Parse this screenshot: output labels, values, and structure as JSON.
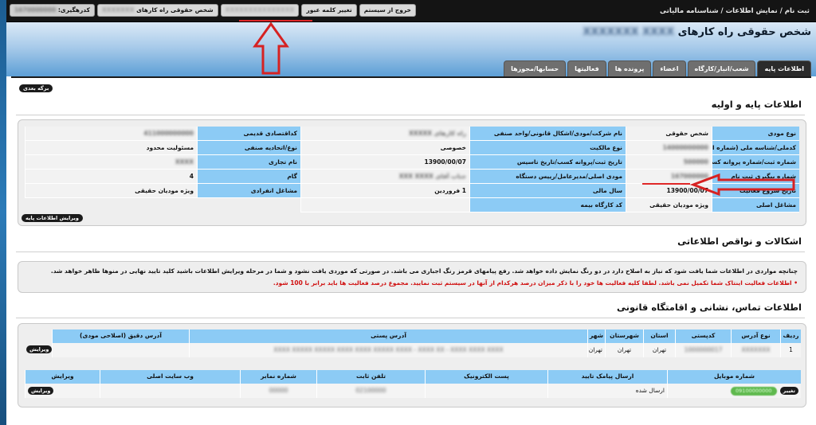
{
  "topbar": {
    "path": "ثبت نام / نمایش اطلاعات / شناسنامه مالیاتی",
    "buttons": {
      "exit": "خروج از سیستم",
      "change_password": "تغییر کلمه عبور",
      "blurred": "XXXXXXXXXXXXXXX",
      "profile_prefix": "شخص حقوقی راه کارهای",
      "profile_blur": "XXXXXXX",
      "tracking_label": "کدرهگیری:",
      "tracking_blur": "1670000000"
    }
  },
  "header": {
    "title": "شخص حقوقی راه کارهای",
    "title_blur": "XXXXXXX XXXX"
  },
  "tabs": [
    {
      "label": "اطلاعات پایه",
      "active": true
    },
    {
      "label": "شعب/انبار/کارگاه",
      "active": false
    },
    {
      "label": "اعضاء",
      "active": false
    },
    {
      "label": "پرونده ها",
      "active": false
    },
    {
      "label": "فعالیتها",
      "active": false
    },
    {
      "label": "حسابها/مجوزها",
      "active": false
    }
  ],
  "next_button": "برگه بعدی",
  "basic_section": {
    "title": "اطلاعات پایه و اولیه",
    "rows": [
      [
        "نوع مودی",
        "شخص حقوقی",
        "نام شرکت/مودی/اشکال قانونی/واحد صنفی",
        "راه کارهای XXXXX",
        "کداقتصادی قدیمی",
        "411000000000"
      ],
      [
        "کدملی/شناسه ملی (شماره اقتصادی)",
        "14000000000",
        "نوع مالکیت",
        "خصوصی",
        "نوع/اتحادیه صنفی",
        "مسئولیت محدود"
      ],
      [
        "شماره ثبت/شماره پروانه کسب",
        "500000",
        "تاریخ ثبت/پروانه کسب/تاریخ تاسیس",
        "13900/00/07",
        "نام تجاری",
        "XXXX"
      ],
      [
        "شماره پیگیری ثبت نام",
        "167000000",
        "مودی اصلی/مدیرعامل/رییس دستگاه",
        "جناب آقای XXX XXXX",
        "گام",
        "4"
      ],
      [
        "تاریخ شروع فعالیت",
        "13900/00/07",
        "سال مالی",
        "1 فروردین",
        "مشاغل انفرادی",
        "ویژه مودیان حقیقی"
      ],
      [
        "مشاغل اصلی",
        "ویژه مودیان حقیقی",
        "کد کارگاه بیمه",
        "",
        "",
        ""
      ]
    ],
    "edit_button": "ویرایش اطلاعات پایه"
  },
  "issues_section": {
    "title": "اشکالات و نواقص اطلاعاتی",
    "line1": "چنانچه مواردی در اطلاعات شما یافت شود که نیاز به اصلاح دارد در دو رنگ نمایش داده خواهد شد. رفع پیامهای قرمز رنگ اجباری می باشد. در صورتی که موردی یافت نشود و شما در مرحله ویرایش اطلاعات باشید کلید تایید نهایی در منوها ظاهر خواهد شد.",
    "line2": "• اطلاعات فعالیت اینتاک شما تکمیل نمی باشد. لطفا کلیه فعالیت ها خود را با ذکر میزان درصد هرکدام از آنها در سیستم ثبت نمایید. مجموع درصد فعالیت ها باید برابر با 100 شود."
  },
  "contact_section": {
    "title": "اطلاعات تماس، نشانی و اقامتگاه قانونی",
    "address_headers": [
      "ردیف",
      "نوع آدرس",
      "کدپستی",
      "استان",
      "شهرستان",
      "شهر",
      "آدرس پستی",
      "آدرس دقیق (اصلاحی مودی)"
    ],
    "address_row": [
      "1",
      "XXXXXXX",
      "1000000017",
      "تهران",
      "تهران",
      "تهران",
      "XXXX XXXXX XXXXX XXXX XXXX XXXXX XXXX - XXXX XX - XXXX XXXX XXXX",
      ""
    ],
    "edit_label": "ویرایش",
    "contact_headers": [
      "شماره موبایل",
      "ارسال پیامک تایید",
      "پست الکترونیک",
      "تلفن ثابت",
      "شماره نمابر",
      "وب سایت اصلی",
      "ویرایش"
    ],
    "contact_row": [
      "09100000000",
      "ارسال شده",
      "",
      "02100000",
      "00000",
      "",
      "ویرایش"
    ],
    "change_label": "تغییر"
  }
}
